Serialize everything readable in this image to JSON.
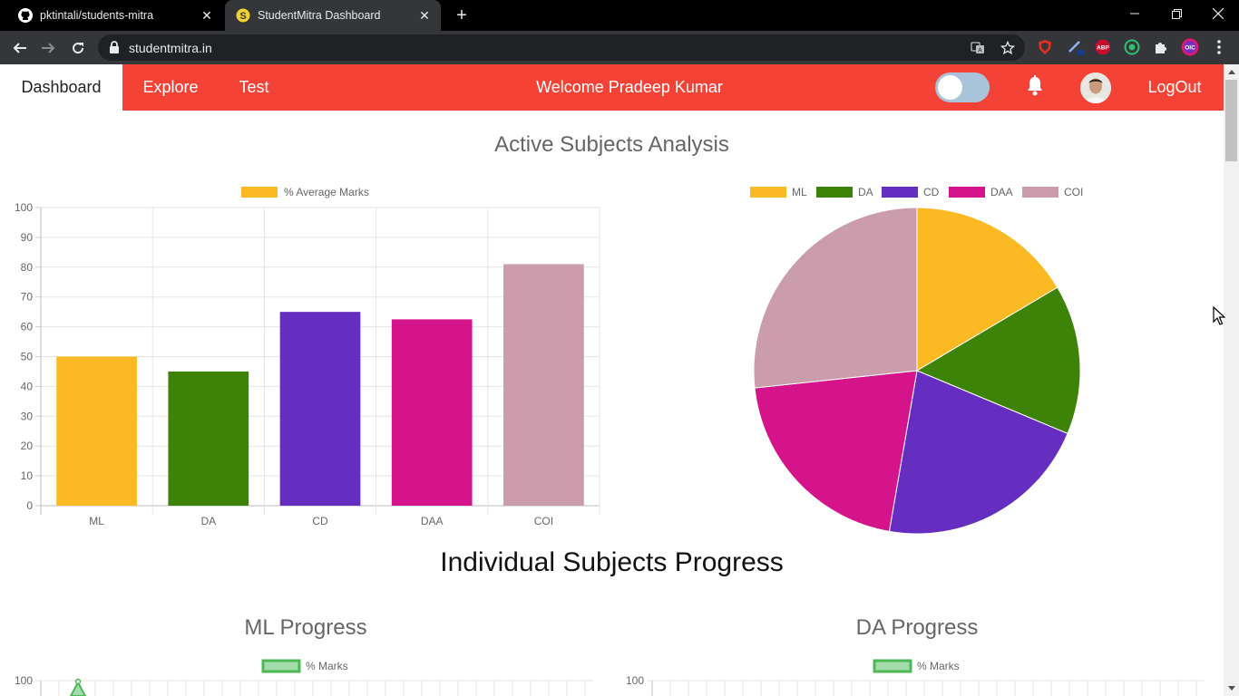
{
  "browser": {
    "tabs": [
      {
        "title": "pktintali/students-mitra",
        "icon": "github-icon",
        "active": false
      },
      {
        "title": "StudentMitra Dashboard",
        "icon": "s-logo-icon",
        "active": true
      }
    ],
    "url": "studentmitra.in"
  },
  "header": {
    "nav": [
      {
        "label": "Dashboard",
        "active": true
      },
      {
        "label": "Explore",
        "active": false
      },
      {
        "label": "Test",
        "active": false
      }
    ],
    "welcome": "Welcome Pradeep Kumar",
    "logout": "LogOut",
    "accent_color": "#f44336"
  },
  "sections": {
    "active_title": "Active Subjects Analysis",
    "individual_title": "Individual Subjects Progress",
    "ml_title": "ML Progress",
    "da_title": "DA Progress"
  },
  "chart_data": [
    {
      "type": "bar",
      "legend": [
        "% Average Marks"
      ],
      "categories": [
        "ML",
        "DA",
        "CD",
        "DAA",
        "COI"
      ],
      "values": [
        50,
        45,
        65,
        62.5,
        81
      ],
      "colors": [
        "#fbb923",
        "#3c8308",
        "#652ec1",
        "#d5148b",
        "#cb9cac"
      ],
      "legend_color": "#fbb923",
      "ylim": [
        0,
        100
      ],
      "yticks": [
        0,
        10,
        20,
        30,
        40,
        50,
        60,
        70,
        80,
        90,
        100
      ],
      "grid": true,
      "legend_position": "top"
    },
    {
      "type": "pie",
      "categories": [
        "ML",
        "DA",
        "CD",
        "DAA",
        "COI"
      ],
      "values": [
        50,
        45,
        65,
        62.5,
        81
      ],
      "colors": [
        "#fbb923",
        "#3c8308",
        "#652ec1",
        "#d5148b",
        "#cb9cac"
      ],
      "legend_position": "top"
    },
    {
      "type": "line",
      "legend": [
        "% Marks"
      ],
      "visible_ytick": "100",
      "line_color": "#4cb954",
      "fill_color": "#a3dcaa"
    },
    {
      "type": "line",
      "legend": [
        "% Marks"
      ],
      "visible_ytick": "100",
      "line_color": "#4cb954",
      "fill_color": "#a3dcaa"
    }
  ]
}
